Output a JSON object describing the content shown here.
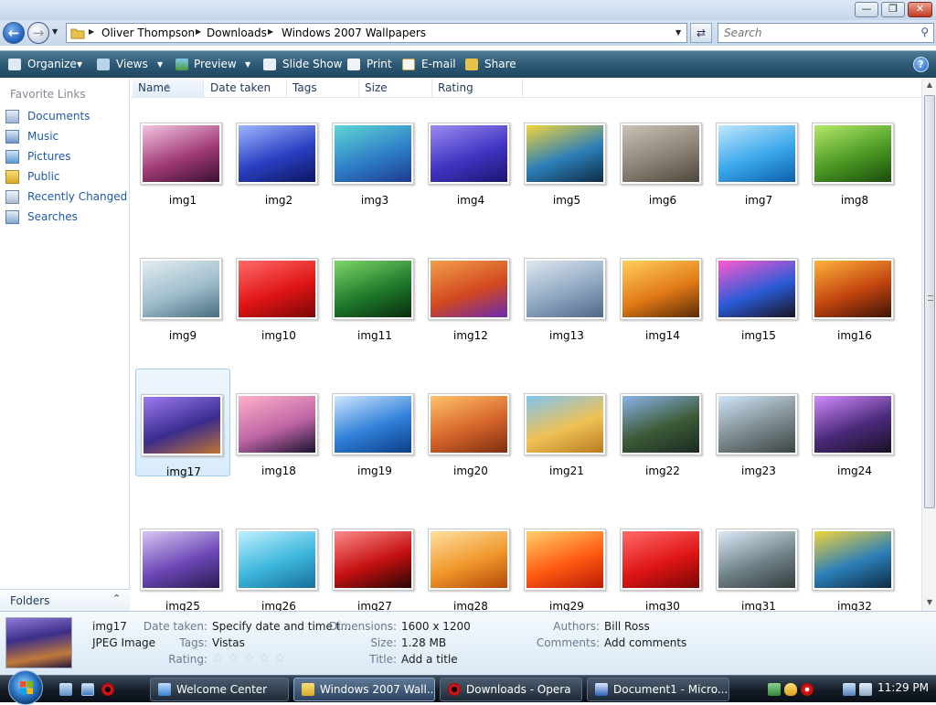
{
  "window": {
    "buttons": {
      "minimize": "—",
      "maximize": "❐",
      "close": "✕"
    }
  },
  "address": {
    "crumbs": [
      "Oliver Thompson",
      "Downloads",
      "Windows 2007 Wallpapers"
    ],
    "search_placeholder": "Search"
  },
  "toolbar": {
    "organize": "Organize",
    "views": "Views",
    "preview": "Preview",
    "slideshow": "Slide Show",
    "print": "Print",
    "email": "E-mail",
    "share": "Share",
    "help": "?"
  },
  "nav": {
    "favorite_links_title": "Favorite Links",
    "items": [
      "Documents",
      "Music",
      "Pictures",
      "Public",
      "Recently Changed",
      "Searches"
    ],
    "folders_label": "Folders"
  },
  "columns": [
    "Name",
    "Date taken",
    "Tags",
    "Size",
    "Rating"
  ],
  "files": [
    {
      "name": "img1",
      "colors": [
        "#f3c6e1",
        "#a13b77",
        "#3a1030"
      ]
    },
    {
      "name": "img2",
      "colors": [
        "#9fb6ff",
        "#2a3fc2",
        "#0c1660"
      ]
    },
    {
      "name": "img3",
      "colors": [
        "#5fd6d6",
        "#2f7fc7",
        "#1d3a8f"
      ]
    },
    {
      "name": "img4",
      "colors": [
        "#9b8cf0",
        "#4034c2",
        "#1b1570"
      ]
    },
    {
      "name": "img5",
      "colors": [
        "#f1d43a",
        "#2c7fb8",
        "#0d2b45"
      ]
    },
    {
      "name": "img6",
      "colors": [
        "#c9c2b6",
        "#8b8275",
        "#4e463c"
      ]
    },
    {
      "name": "img7",
      "colors": [
        "#bfe7ff",
        "#3aa7ea",
        "#0c5ea8"
      ]
    },
    {
      "name": "img8",
      "colors": [
        "#b5e86a",
        "#4a9a24",
        "#1d4a0c"
      ]
    },
    {
      "name": "img9",
      "colors": [
        "#e3eef2",
        "#9fbccb",
        "#486d80"
      ]
    },
    {
      "name": "img10",
      "colors": [
        "#ff6a6a",
        "#e01515",
        "#7a0606"
      ]
    },
    {
      "name": "img11",
      "colors": [
        "#7fd66a",
        "#1f7a2a",
        "#0a2b10"
      ]
    },
    {
      "name": "img12",
      "colors": [
        "#f0a04a",
        "#d3481f",
        "#6a2ab0"
      ]
    },
    {
      "name": "img13",
      "colors": [
        "#dfe8f1",
        "#8fa7c1",
        "#4f6886"
      ]
    },
    {
      "name": "img14",
      "colors": [
        "#ffcf5a",
        "#e27a16",
        "#5a2c06"
      ]
    },
    {
      "name": "img15",
      "colors": [
        "#ff5ad0",
        "#2a5bd6",
        "#1a1420"
      ]
    },
    {
      "name": "img16",
      "colors": [
        "#ffb23a",
        "#c2440f",
        "#3c1406"
      ]
    },
    {
      "name": "img17",
      "colors": [
        "#9c7bf0",
        "#3a2c8f",
        "#c07432"
      ]
    },
    {
      "name": "img18",
      "colors": [
        "#ffb0c8",
        "#c066a6",
        "#1a1230"
      ]
    },
    {
      "name": "img19",
      "colors": [
        "#cfe7ff",
        "#2f7fd8",
        "#0b3d86"
      ]
    },
    {
      "name": "img20",
      "colors": [
        "#ffc26a",
        "#d6642a",
        "#7a2f12"
      ]
    },
    {
      "name": "img21",
      "colors": [
        "#7fc3f0",
        "#f0c256",
        "#b87a20"
      ]
    },
    {
      "name": "img22",
      "colors": [
        "#8ab4ea",
        "#3d5a36",
        "#1a2a24"
      ]
    },
    {
      "name": "img23",
      "colors": [
        "#cfe4f8",
        "#7c8a8e",
        "#3b4344"
      ]
    },
    {
      "name": "img24",
      "colors": [
        "#d48aff",
        "#4a2a7a",
        "#1a1024"
      ]
    },
    {
      "name": "img25",
      "colors": [
        "#d8c6f4",
        "#6c48b6",
        "#2a1a50"
      ]
    },
    {
      "name": "img26",
      "colors": [
        "#bff0ff",
        "#3cb6dc",
        "#1a6e9a"
      ]
    },
    {
      "name": "img27",
      "colors": [
        "#ff8a8a",
        "#c41010",
        "#2a0606"
      ]
    },
    {
      "name": "img28",
      "colors": [
        "#ffe0a0",
        "#f0962a",
        "#b2480a"
      ]
    },
    {
      "name": "img29",
      "colors": [
        "#ffcf6a",
        "#ff5a12",
        "#b81a06"
      ]
    },
    {
      "name": "img30",
      "colors": [
        "#ff6a6a",
        "#e01515",
        "#7a0606"
      ]
    },
    {
      "name": "img31",
      "colors": [
        "#dceaf8",
        "#6f8288",
        "#333c3d"
      ]
    },
    {
      "name": "img32",
      "colors": [
        "#f1d43a",
        "#2c7fb8",
        "#0d2b45"
      ]
    }
  ],
  "selected_index": 16,
  "details": {
    "name": "img17",
    "type": "JPEG Image",
    "date_taken_label": "Date taken:",
    "date_taken_value": "Specify date and time t...",
    "tags_label": "Tags:",
    "tags_value": "Vistas",
    "rating_label": "Rating:",
    "rating_stars": 0,
    "dimensions_label": "Dimensions:",
    "dimensions_value": "1600 x 1200",
    "size_label": "Size:",
    "size_value": "1.28 MB",
    "title_label": "Title:",
    "title_value": "Add a title",
    "authors_label": "Authors:",
    "authors_value": "Bill Ross",
    "comments_label": "Comments:",
    "comments_value": "Add comments"
  },
  "taskbar": {
    "tasks": [
      "Welcome Center",
      "Windows 2007 Wall...",
      "Downloads - Opera",
      "Document1 - Micro..."
    ],
    "active_index": 1,
    "clock": "11:29 PM"
  }
}
